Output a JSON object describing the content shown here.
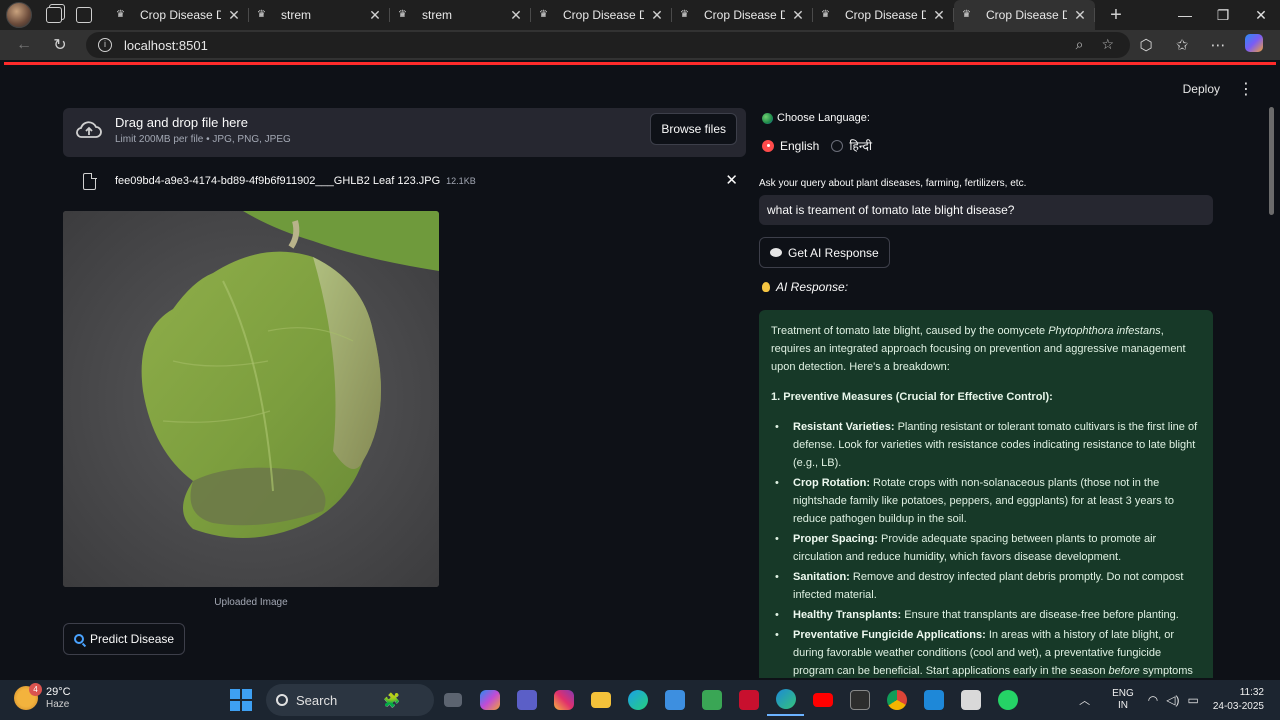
{
  "browser": {
    "tabs": [
      {
        "title": "Crop Disease Detecti",
        "active": false
      },
      {
        "title": "strem",
        "active": false
      },
      {
        "title": "strem",
        "active": false
      },
      {
        "title": "Crop Disease Detecti",
        "active": false
      },
      {
        "title": "Crop Disease Detecti",
        "active": false
      },
      {
        "title": "Crop Disease Detecti",
        "active": false
      },
      {
        "title": "Crop Disease Detecti",
        "active": true
      }
    ],
    "url": "localhost:8501"
  },
  "app": {
    "deploy_label": "Deploy",
    "uploader": {
      "title": "Drag and drop file here",
      "limit": "Limit 200MB per file • JPG, PNG, JPEG",
      "browse_label": "Browse files"
    },
    "file": {
      "name": "fee09bd4-a9e3-4174-bd89-4f9b6f911902___GHLB2 Leaf 123.JPG",
      "size": "12.1KB"
    },
    "image_caption": "Uploaded Image",
    "predict_label": "Predict Disease",
    "language": {
      "label": "Choose Language:",
      "options": [
        "English",
        "हिन्दी"
      ],
      "selected": "English"
    },
    "query": {
      "label": "Ask your query about plant diseases, farming, fertilizers, etc.",
      "value": "what is treament of tomato late blight disease?"
    },
    "ai_button_label": "Get AI Response",
    "response_label": "AI Response:",
    "response": {
      "intro_before": "Treatment of tomato late blight, caused by the oomycete ",
      "intro_italic": "Phytophthora infestans",
      "intro_after": ", requires an integrated approach focusing on prevention and aggressive management upon detection. Here's a breakdown:",
      "heading": "1. Preventive Measures (Crucial for Effective Control):",
      "items": [
        {
          "term": "Resistant Varieties:",
          "text": "Planting resistant or tolerant tomato cultivars is the first line of defense. Look for varieties with resistance codes indicating resistance to late blight (e.g., LB)."
        },
        {
          "term": "Crop Rotation:",
          "text": "Rotate crops with non-solanaceous plants (those not in the nightshade family like potatoes, peppers, and eggplants) for at least 3 years to reduce pathogen buildup in the soil."
        },
        {
          "term": "Proper Spacing:",
          "text": "Provide adequate spacing between plants to promote air circulation and reduce humidity, which favors disease development."
        },
        {
          "term": "Sanitation:",
          "text": "Remove and destroy infected plant debris promptly. Do not compost infected material."
        },
        {
          "term": "Healthy Transplants:",
          "text": "Ensure that transplants are disease-free before planting."
        },
        {
          "term": "Preventative Fungicide Applications:",
          "text": "In areas with a history of late blight, or during favorable weather conditions (cool and wet), a preventative fungicide program can be beneficial. Start applications early in the season",
          "italic_tail": "before",
          "tail": "symptoms"
        }
      ]
    }
  },
  "taskbar": {
    "weather_temp": "29°C",
    "weather_cond": "Haze",
    "weather_badge": "4",
    "search_label": "Search",
    "lang_line1": "ENG",
    "lang_line2": "IN",
    "time": "11:32",
    "date": "24-03-2025"
  }
}
